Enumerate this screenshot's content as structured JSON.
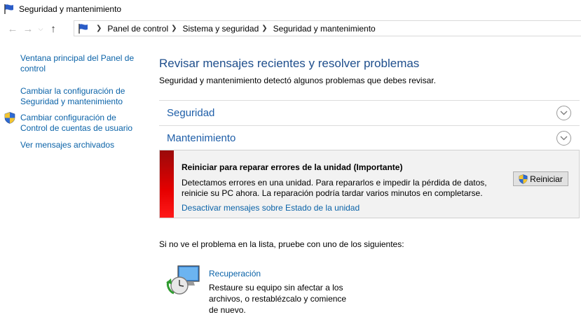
{
  "window": {
    "title": "Seguridad y mantenimiento"
  },
  "nav": {
    "back_icon": "arrow-left-icon",
    "forward_icon": "arrow-right-icon",
    "recent_icon": "chevron-down-icon",
    "up_icon": "arrow-up-icon",
    "breadcrumb": [
      "Panel de control",
      "Sistema y seguridad",
      "Seguridad y mantenimiento"
    ]
  },
  "sidebar": {
    "links": [
      "Ventana principal del Panel de control",
      "Cambiar la configuración de Seguridad y mantenimiento",
      "Cambiar configuración de Control de cuentas de usuario",
      "Ver mensajes archivados"
    ]
  },
  "main": {
    "heading": "Revisar mensajes recientes y resolver problemas",
    "subtitle": "Seguridad y mantenimiento detectó algunos problemas que debes revisar.",
    "sections": [
      {
        "title": "Seguridad"
      },
      {
        "title": "Mantenimiento"
      }
    ],
    "alert": {
      "title": "Reiniciar para reparar errores de la unidad  (Importante)",
      "description": "Detectamos errores en una unidad. Para repararlos e impedir la pérdida de datos, reinicie su PC ahora. La reparación podría tardar varios minutos en completarse.",
      "link": "Desactivar mensajes sobre Estado de la unidad",
      "button_label": "Reiniciar",
      "severity_color": "#e60000"
    },
    "hint": "Si no ve el problema en la lista, pruebe con uno de los siguientes:",
    "recovery": {
      "title": "Recuperación",
      "description": "Restaure su equipo sin afectar a los archivos, o restablézcalo y comience de nuevo."
    }
  },
  "colors": {
    "link": "#0b63a8",
    "heading": "#1e4e8c"
  }
}
